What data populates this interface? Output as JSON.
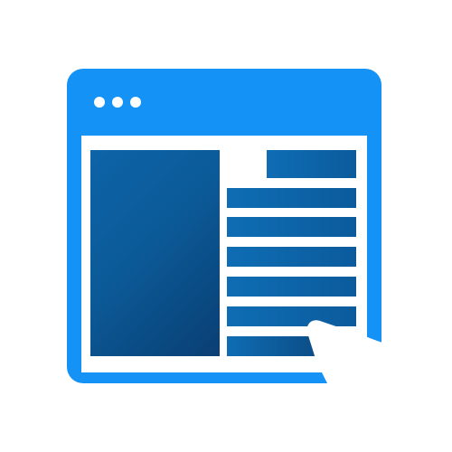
{
  "window": {
    "title_bar_dots": [
      "dot",
      "dot",
      "dot"
    ]
  },
  "icons": {
    "cursor": "hand-pointer-icon"
  },
  "colors": {
    "window_frame": "#1592f5",
    "content_blocks": "#0b5b9c",
    "content_background": "#ffffff",
    "cursor": "#ffffff"
  }
}
